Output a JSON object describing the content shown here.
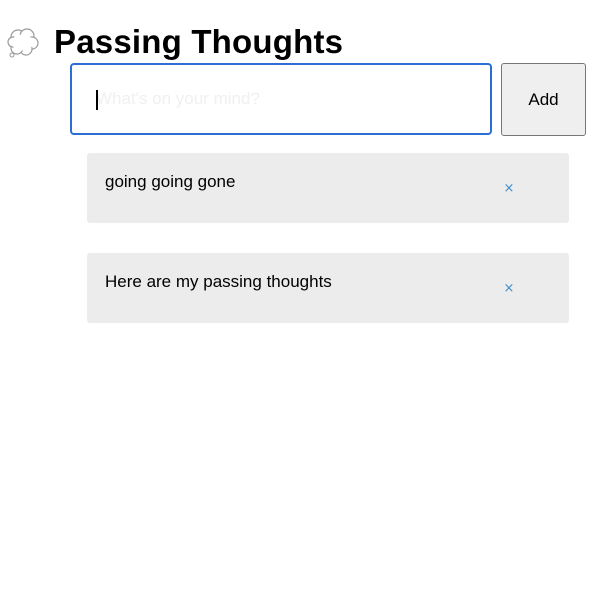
{
  "header": {
    "icon": "thought-bubble-icon",
    "title": "Passing Thoughts"
  },
  "form": {
    "value": "",
    "placeholder": "What's on your mind?",
    "add_label": "Add",
    "focus_color": "#2b6fd6"
  },
  "thoughts": [
    {
      "text": "going going gone",
      "remove_label": "×"
    },
    {
      "text": "Here are my passing thoughts",
      "remove_label": "×"
    }
  ],
  "colors": {
    "item_background": "#ececec",
    "remove_color": "#3d8fd0"
  }
}
